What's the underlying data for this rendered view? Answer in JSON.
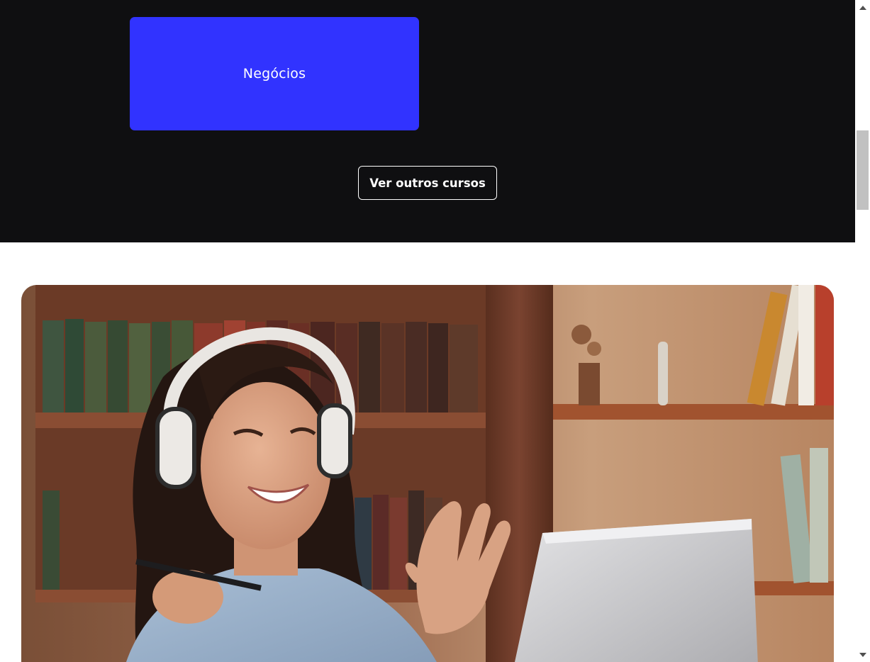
{
  "categories": [
    {
      "label": "Negócios",
      "color": "#3133ff"
    }
  ],
  "actions": {
    "more_courses_label": "Ver outros cursos"
  },
  "hero": {
    "image": "woman-with-headphones-video-call-photo"
  },
  "colors": {
    "dark_section": "#0f0f11",
    "accent": "#3133ff",
    "text_light": "#ffffff"
  },
  "icons": {
    "scroll_up": "scroll-up-arrow-icon",
    "scroll_down": "scroll-down-arrow-icon"
  }
}
